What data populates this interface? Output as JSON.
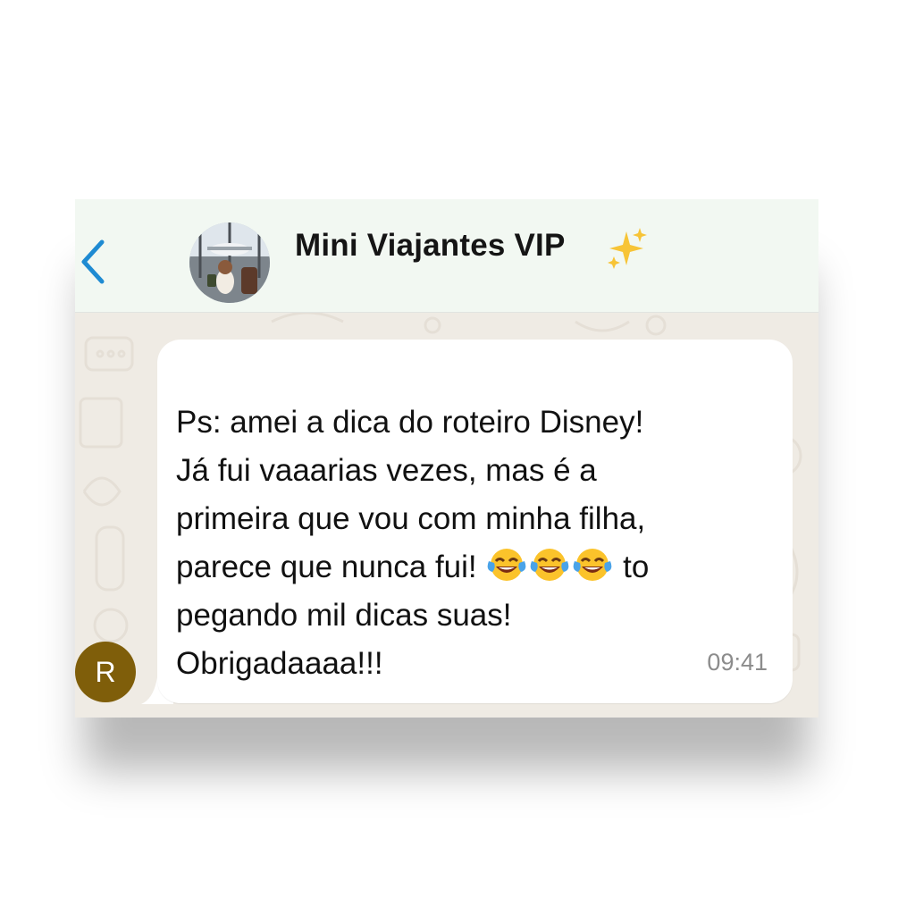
{
  "header": {
    "title": "Mini Viajantes VIP",
    "title_emoji": "sparkles",
    "back_icon": "chevron-left-icon",
    "accent": "#1f8bd2"
  },
  "chat": {
    "sender_initial": "R",
    "sender_color": "#7f5e0a",
    "message": {
      "line1": "Ps: amei a dica do roteiro Disney!",
      "line2": "Já fui vaaarias vezes, mas é a",
      "line3": "primeira que vou com minha filha,",
      "line4_text": "parece que nunca fui!",
      "line4_emoji": "face-with-tears-of-joy",
      "line4_tail": "to",
      "line5": "pegando mil dicas suas!",
      "line6": "Obrigadaaaa!!!",
      "time": "09:41"
    }
  }
}
